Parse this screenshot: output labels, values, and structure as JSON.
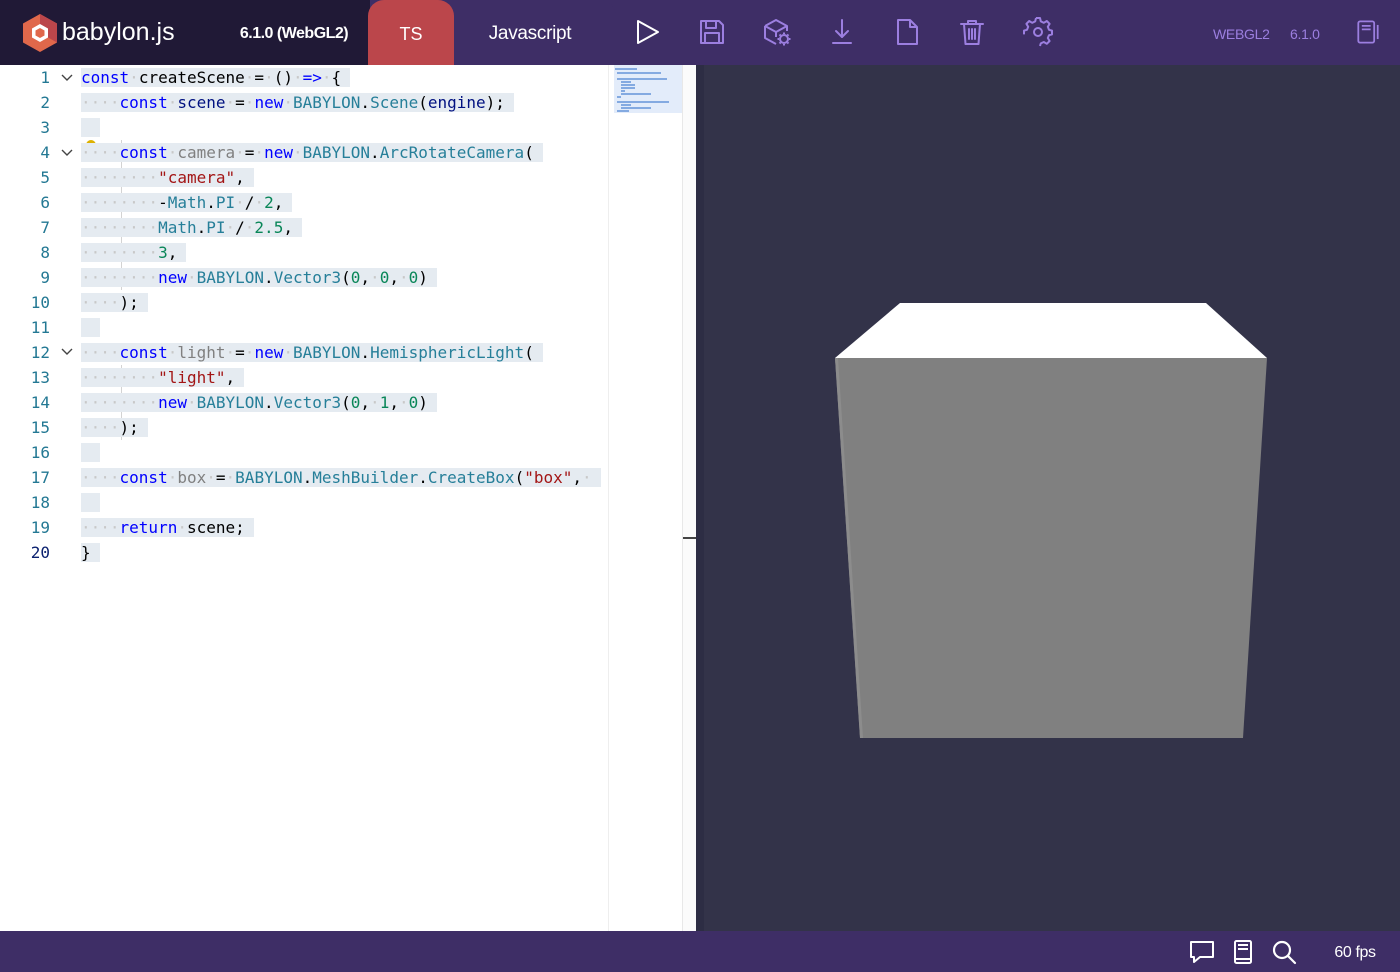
{
  "header": {
    "logo_text": "babylon.js",
    "version": "6.1.0 (WebGL2)",
    "tabs": [
      {
        "label": "TS",
        "active": true
      },
      {
        "label": "Javascript",
        "active": false
      }
    ],
    "toolbar_icons": [
      "play-icon",
      "save-icon",
      "inspector-icon",
      "download-icon",
      "new-file-icon",
      "delete-icon",
      "settings-icon"
    ],
    "engine": "WEBGL2",
    "engine_version": "6.1.0",
    "examples_icon": "examples-icon"
  },
  "editor": {
    "line_numbers": [
      "1",
      "2",
      "3",
      "4",
      "5",
      "6",
      "7",
      "8",
      "9",
      "10",
      "11",
      "12",
      "13",
      "14",
      "15",
      "16",
      "17",
      "18",
      "19",
      "20"
    ],
    "current_line": "20",
    "code_lines": [
      "const createScene = () => {",
      "    const scene = new BABYLON.Scene(engine);",
      "",
      "    const camera = new BABYLON.ArcRotateCamera(",
      "        \"camera\",",
      "        -Math.PI / 2,",
      "        Math.PI / 2.5,",
      "        3,",
      "        new BABYLON.Vector3(0, 0, 0)",
      "    );",
      "",
      "    const light = new BABYLON.HemisphericLight(",
      "        \"light\",",
      "        new BABYLON.Vector3(0, 1, 0)",
      "    );",
      "",
      "    const box = BABYLON.MeshBuilder.CreateBox(\"box\",",
      "",
      "    return scene;",
      "}"
    ]
  },
  "footer": {
    "icons": [
      "feedback-icon",
      "docs-icon",
      "search-icon"
    ],
    "fps": "60 fps"
  },
  "colors": {
    "header_bg": "#3e2e66",
    "logo_bg": "#201936",
    "ts_tab": "#bb464b",
    "canvas_bg": "#333349",
    "engine_label": "#9c7fe0"
  }
}
